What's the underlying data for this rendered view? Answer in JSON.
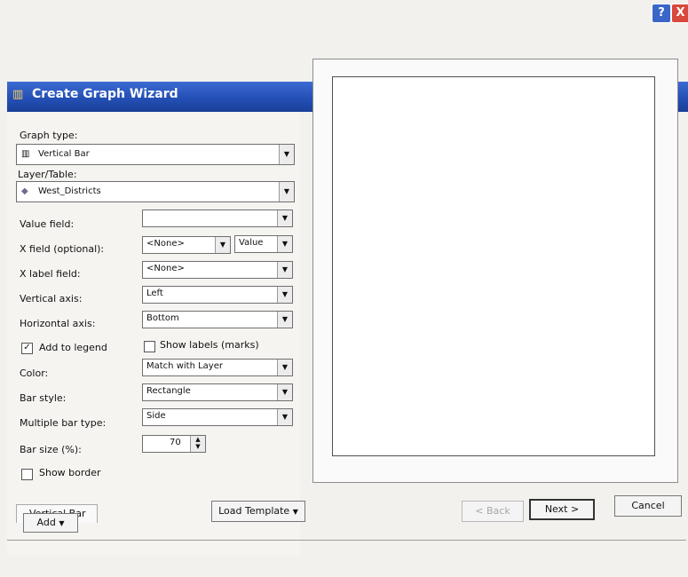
{
  "window": {
    "title": "Create Graph Wizard",
    "help_glyph": "?",
    "close_glyph": "X"
  },
  "form": {
    "graph_type_label": "Graph type:",
    "graph_type_value": "Vertical Bar",
    "layer_label": "Layer/Table:",
    "layer_value": "West_Districts",
    "value_field_label": "Value field:",
    "value_field_value": "",
    "x_field_label": "X field (optional):",
    "x_field_value": "<None>",
    "x_field_sort_value": "Value",
    "x_label_field_label": "X label field:",
    "x_label_field_value": "<None>",
    "vertical_axis_label": "Vertical axis:",
    "vertical_axis_value": "Left",
    "horizontal_axis_label": "Horizontal axis:",
    "horizontal_axis_value": "Bottom",
    "add_to_legend_label": "Add to legend",
    "add_to_legend_checked": true,
    "show_labels_label": "Show labels (marks)",
    "show_labels_checked": false,
    "color_label": "Color:",
    "color_value": "Match with Layer",
    "bar_style_label": "Bar style:",
    "bar_style_value": "Rectangle",
    "multiple_bar_type_label": "Multiple bar type:",
    "multiple_bar_type_value": "Side",
    "bar_size_label": "Bar size (%):",
    "bar_size_value": "70",
    "show_border_label": "Show border",
    "show_border_checked": false
  },
  "tabs": {
    "active_tab": "Vertical Bar",
    "add_label": "Add"
  },
  "buttons": {
    "load_template": "Load Template",
    "back": "< Back",
    "next": "Next >",
    "cancel": "Cancel"
  }
}
